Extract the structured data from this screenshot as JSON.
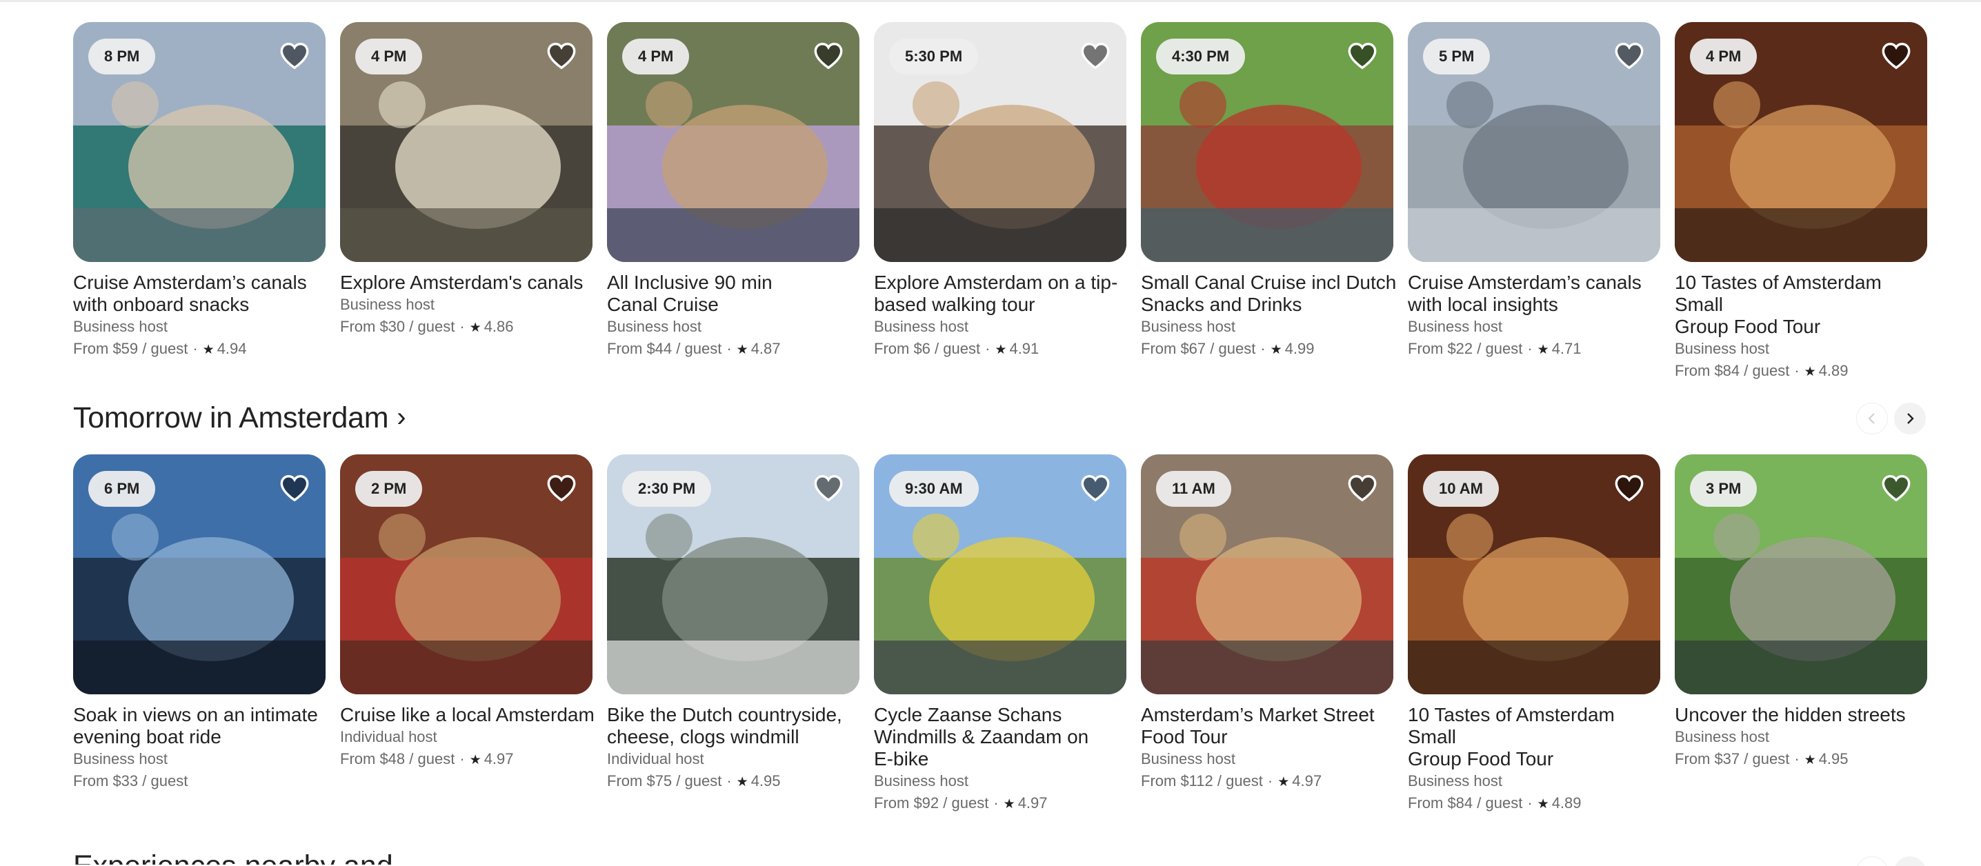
{
  "row1": [
    {
      "time": "8 PM",
      "title": "Cruise Amsterdam’s canals\nwith onboard snacks",
      "host": "Business host",
      "price": "From $59 / guest",
      "rating": "4.94",
      "colors": [
        "#9fb0c4",
        "#1f6f66",
        "#d8c7ae",
        "#5d6b73"
      ]
    },
    {
      "time": "4 PM",
      "title": "Explore Amsterdam's canals",
      "host": "Business host",
      "price": "From $30 / guest",
      "rating": "4.86",
      "colors": [
        "#8a7f6a",
        "#3d3a33",
        "#e9e1cf",
        "#5a5748"
      ]
    },
    {
      "time": "4 PM",
      "title": "All Inclusive 90 min\nCanal Cruise",
      "host": "Business host",
      "price": "From $44 / guest",
      "rating": "4.87",
      "colors": [
        "#6f7b55",
        "#b59fd0",
        "#c6a077",
        "#3b4355"
      ]
    },
    {
      "time": "5:30 PM",
      "title": "Explore Amsterdam on a tip-\nbased walking tour",
      "host": "Business host",
      "price": "From $6 / guest",
      "rating": "4.91",
      "colors": [
        "#e9e9e9",
        "#4b3f37",
        "#c9a57d",
        "#2b2a29"
      ]
    },
    {
      "time": "4:30 PM",
      "title": "Small Canal Cruise incl Dutch\nSnacks and Drinks",
      "host": "Business host",
      "price": "From $67 / guest",
      "rating": "4.99",
      "colors": [
        "#6fa04a",
        "#8b4a3a",
        "#b8352c",
        "#3e5e6b"
      ]
    },
    {
      "time": "5 PM",
      "title": "Cruise Amsterdam’s canals\nwith local insights",
      "host": "Business host",
      "price": "From $22 / guest",
      "rating": "4.71",
      "colors": [
        "#a7b4c4",
        "#9aa3ab",
        "#6d7783",
        "#c9cfd6"
      ]
    },
    {
      "time": "4 PM",
      "title": "10 Tastes of Amsterdam Small\nGroup Food Tour",
      "host": "Business host",
      "price": "From $84 / guest",
      "rating": "4.89",
      "colors": [
        "#5a2b18",
        "#a35a2c",
        "#d79a5c",
        "#2d1d14"
      ]
    }
  ],
  "section": {
    "title": "Tomorrow in Amsterdam",
    "chevron": "›"
  },
  "row2": [
    {
      "time": "6 PM",
      "title": "Soak in views on an intimate\nevening boat ride",
      "host": "Business host",
      "price": "From $33 / guest",
      "rating": "",
      "colors": [
        "#3f6fa8",
        "#1a2a40",
        "#8fb2d6",
        "#0f1724"
      ]
    },
    {
      "time": "2 PM",
      "title": "Cruise like a local Amsterdam",
      "host": "Individual host",
      "price": "From $48 / guest",
      "rating": "4.97",
      "colors": [
        "#7a3a28",
        "#b3322c",
        "#c79b6a",
        "#4b2a20"
      ]
    },
    {
      "time": "2:30 PM",
      "title": "Bike the Dutch countryside,\ncheese, clogs windmill",
      "host": "Individual host",
      "price": "From $75 / guest",
      "rating": "4.95",
      "colors": [
        "#c9d6e3",
        "#2e3a2a",
        "#7f8a80",
        "#e6e6e6"
      ]
    },
    {
      "time": "9:30 AM",
      "title": "Cycle Zaanse Schans\nWindmills & Zaandam on\nE-bike",
      "host": "Business host",
      "price": "From $92 / guest",
      "rating": "4.97",
      "colors": [
        "#8cb4e0",
        "#6c8f3e",
        "#e6cf3a",
        "#3b3f46"
      ]
    },
    {
      "time": "11 AM",
      "title": "Amsterdam’s Market Street\nFood Tour",
      "host": "Business host",
      "price": "From $112 / guest",
      "rating": "4.97",
      "colors": [
        "#8d7a69",
        "#b83b2c",
        "#d9b27c",
        "#3a3a3a"
      ]
    },
    {
      "time": "10 AM",
      "title": "10 Tastes of Amsterdam Small\nGroup Food Tour",
      "host": "Business host",
      "price": "From $84 / guest",
      "rating": "4.89",
      "colors": [
        "#5a2b18",
        "#a35a2c",
        "#d79a5c",
        "#2d1d14"
      ]
    },
    {
      "time": "3 PM",
      "title": "Uncover the hidden streets",
      "host": "Business host",
      "price": "From $37 / guest",
      "rating": "4.95",
      "colors": [
        "#79b35a",
        "#3d6a2e",
        "#a7a29a",
        "#2e3a36"
      ]
    }
  ],
  "star": "★",
  "separator": "·",
  "next_section_title": "Experiences nearby and ..."
}
